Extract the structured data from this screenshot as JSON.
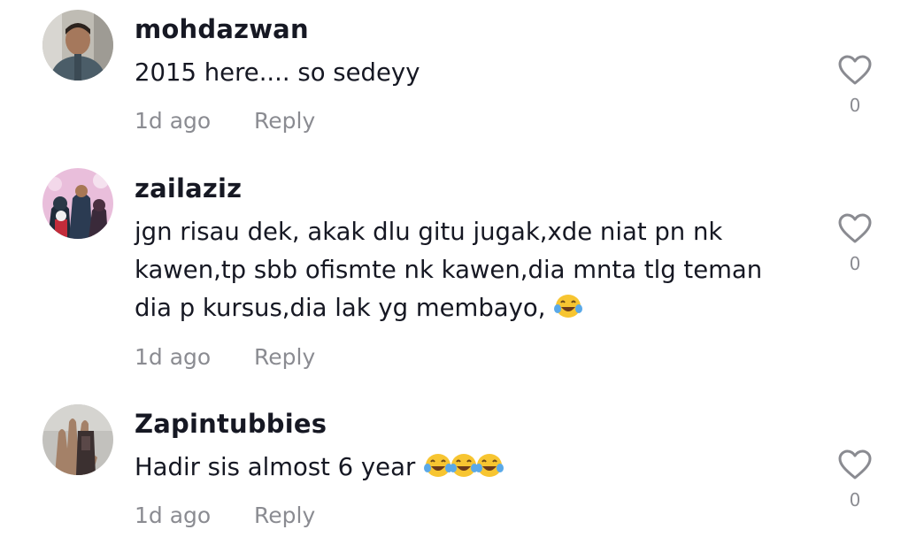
{
  "comments": [
    {
      "username": "mohdazwan",
      "text_lines": [
        "2015 here.... so sedeyy"
      ],
      "emojis": [],
      "timestamp": "1d ago",
      "reply_label": "Reply",
      "like_count": "0",
      "avatar_colors": [
        "#b8b5ae",
        "#4a5f6a"
      ]
    },
    {
      "username": "zailaziz",
      "text_lines": [
        "jgn risau dek, akak dlu gitu jugak,xde niat pn nk",
        "kawen,tp sbb ofismte nk kawen,dia mnta tlg teman",
        "dia p kursus,dia lak yg membayo,"
      ],
      "emojis": [
        "face-with-tears-of-joy"
      ],
      "timestamp": "1d ago",
      "reply_label": "Reply",
      "like_count": "0",
      "avatar_colors": [
        "#e7b7d6",
        "#2a3a4a"
      ]
    },
    {
      "username": "Zapintubbies",
      "text_lines": [
        "Hadir sis almost 6 year"
      ],
      "emojis": [
        "face-with-tears-of-joy",
        "face-with-tears-of-joy",
        "face-with-tears-of-joy"
      ],
      "timestamp": "1d ago",
      "reply_label": "Reply",
      "like_count": "0",
      "avatar_colors": [
        "#bcbcb8",
        "#3a3030"
      ]
    }
  ],
  "icons": {
    "like": "heart-outline-icon",
    "emoji": "face-with-tears-of-joy"
  },
  "colors": {
    "text": "#161823",
    "muted": "rgba(22,24,35,0.5)",
    "heart_stroke": "#8a8b91",
    "emoji_face": "#f7c531",
    "emoji_tears": "#5aa9e8"
  }
}
